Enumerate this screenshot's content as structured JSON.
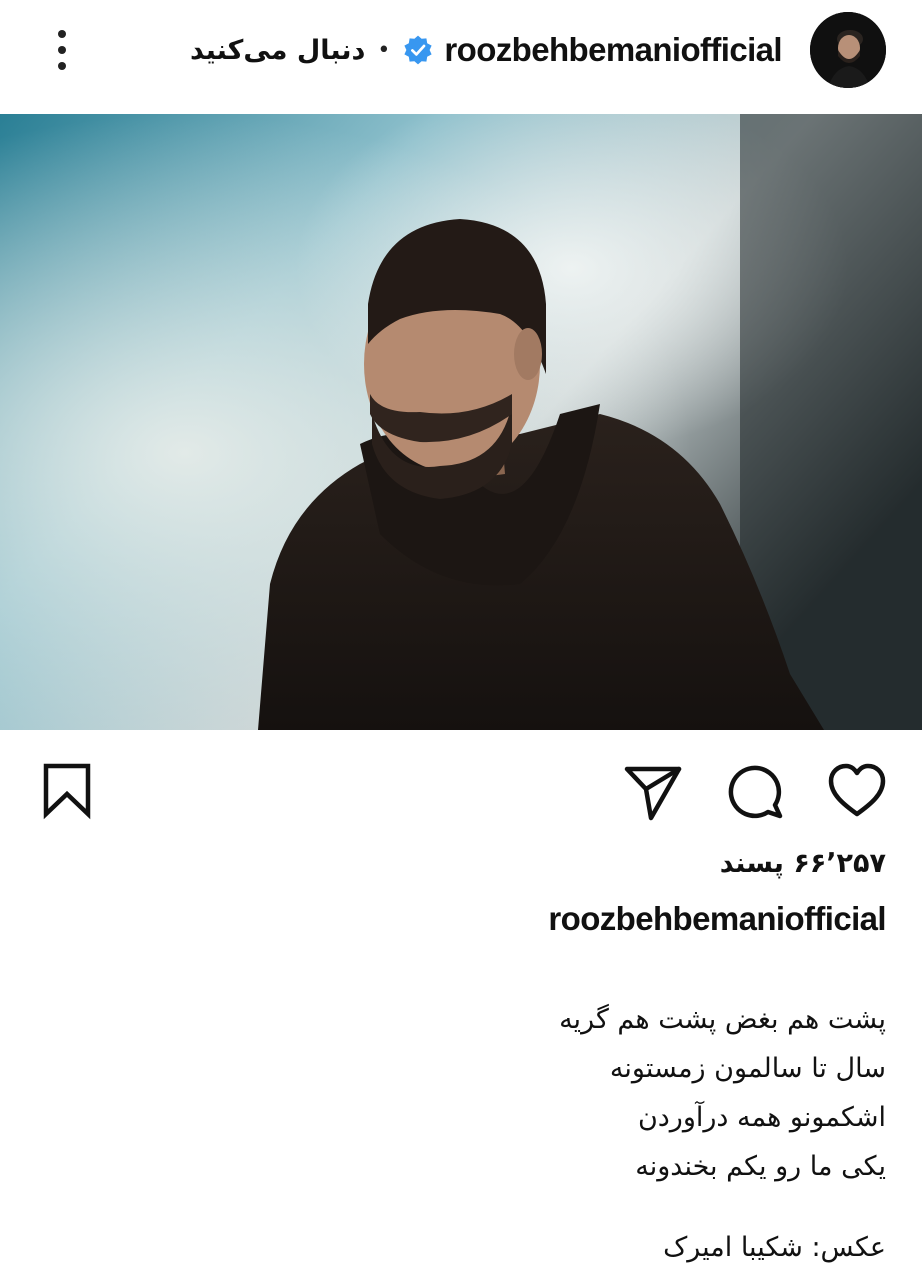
{
  "header": {
    "username": "roozbehbemaniofficial",
    "follow_label": "دنبال می‌کنید",
    "separator": "•",
    "menu_icon": "more-vertical-icon",
    "verified_icon": "verified-badge-icon"
  },
  "post": {
    "actions": {
      "save_icon": "bookmark-icon",
      "share_icon": "send-icon",
      "comment_icon": "comment-icon",
      "like_icon": "heart-icon"
    },
    "likes_text": "۶۶٬۲۵۷ پسند",
    "caption_username": "roozbehbemaniofficial",
    "caption_lines": [
      "پشت هم بغض پشت هم گریه",
      "سال تا سالمون زمستونه",
      "اشکمونو همه درآوردن",
      "یکی ما رو یکم بخندونه"
    ],
    "credit": "عکس: شکیبا امیرک"
  },
  "colors": {
    "verified": "#3897f0",
    "text": "#111111",
    "background": "#ffffff"
  }
}
